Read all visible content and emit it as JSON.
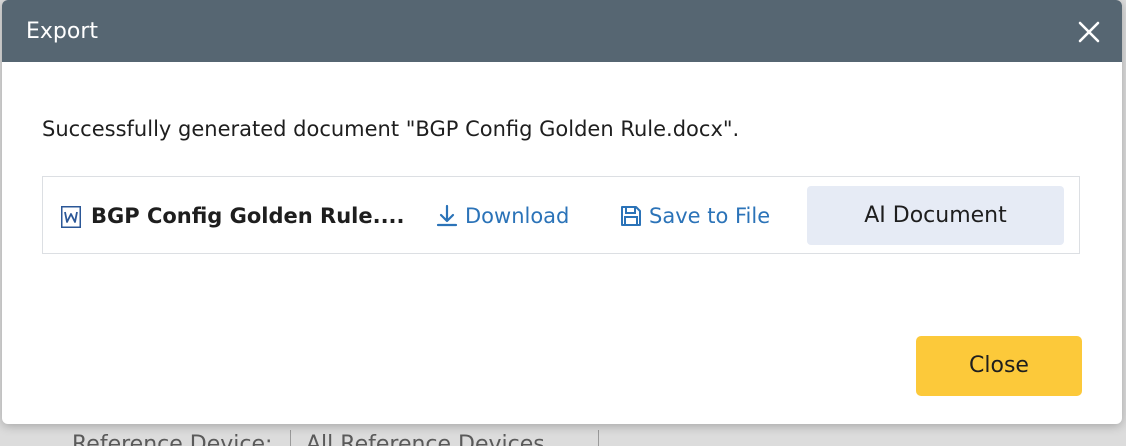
{
  "background": {
    "reference_label": "Reference Device:",
    "reference_value": "All Reference Devices"
  },
  "dialog": {
    "title": "Export",
    "close_icon": "close-icon",
    "message": "Successfully generated document \"BGP Config Golden Rule.docx\".",
    "file": {
      "icon": "word-file-icon",
      "name": "BGP Config Golden Rule...."
    },
    "actions": {
      "download_label": "Download",
      "download_icon": "download-icon",
      "save_label": "Save to File",
      "save_icon": "floppy-disk-icon",
      "ai_label": "AI Document"
    },
    "close_button_label": "Close"
  },
  "colors": {
    "header": "#566672",
    "link": "#2b73b8",
    "ai_button_bg": "#e6ebf5",
    "close_button_bg": "#fcc93a"
  }
}
